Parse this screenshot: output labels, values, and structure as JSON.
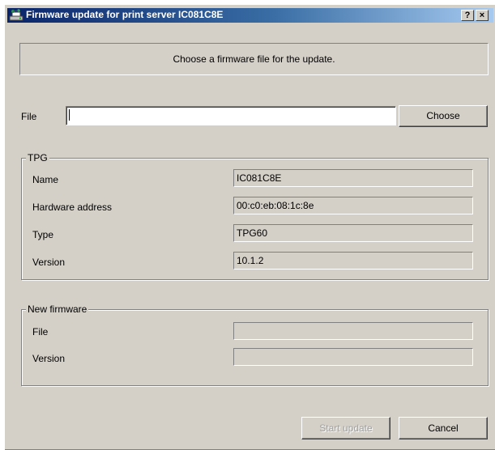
{
  "window": {
    "title": "Firmware update for print server IC081C8E",
    "icon": "network-printer-icon",
    "help_button": "?",
    "close_button": "×"
  },
  "info": {
    "message": "Choose a firmware file for the update."
  },
  "file_row": {
    "label": "File",
    "value": "",
    "choose_label": "Choose"
  },
  "tpg": {
    "legend": "TPG",
    "rows": [
      {
        "label": "Name",
        "value": "IC081C8E"
      },
      {
        "label": "Hardware address",
        "value": "00:c0:eb:08:1c:8e"
      },
      {
        "label": "Type",
        "value": "TPG60"
      },
      {
        "label": "Version",
        "value": "10.1.2"
      }
    ]
  },
  "new_firmware": {
    "legend": "New firmware",
    "rows": [
      {
        "label": "File",
        "value": ""
      },
      {
        "label": "Version",
        "value": ""
      }
    ]
  },
  "buttons": {
    "start_update": "Start update",
    "start_update_enabled": false,
    "cancel": "Cancel"
  },
  "colors": {
    "face": "#d4d0c8",
    "title_start": "#0a246a",
    "title_end": "#a6caf0"
  }
}
